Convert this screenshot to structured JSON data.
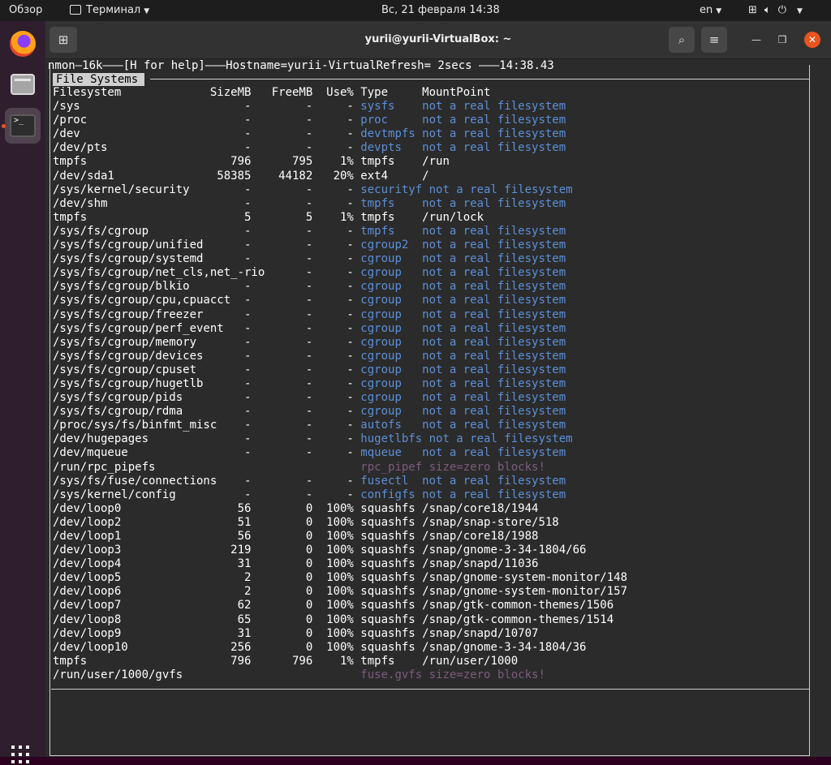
{
  "topbar": {
    "activities": "Обзор",
    "app_menu": "Терминал",
    "clock": "Вс, 21 февраля  14:38",
    "lang": "en"
  },
  "window": {
    "title": "yurii@yurii-VirtualBox: ~"
  },
  "nmon": {
    "header": "nmon—16k———[H for help]———Hostname=yurii-VirtualRefresh= 2secs ———14:38.43",
    "section": "File Systems",
    "columns": "Filesystem             SizeMB   FreeMB  Use% Type     MountPoint",
    "rows": [
      {
        "line": "/sys                        -        -     - ",
        "type": "sysfs    not a real filesystem",
        "style": "dim"
      },
      {
        "line": "/proc                       -        -     - ",
        "type": "proc     not a real filesystem",
        "style": "dim"
      },
      {
        "line": "/dev                        -        -     - ",
        "type": "devtmpfs not a real filesystem",
        "style": "dim"
      },
      {
        "line": "/dev/pts                    -        -     - ",
        "type": "devpts   not a real filesystem",
        "style": "dim"
      },
      {
        "line": "tmpfs                     796      795    1% ",
        "type": "tmpfs    /run",
        "style": "normal"
      },
      {
        "line": "/dev/sda1               58385    44182   20% ",
        "type": "ext4     /",
        "style": "normal"
      },
      {
        "line": "/sys/kernel/security        -        -     - ",
        "type": "securityf not a real filesystem",
        "style": "dim"
      },
      {
        "line": "/dev/shm                    -        -     - ",
        "type": "tmpfs    not a real filesystem",
        "style": "dim"
      },
      {
        "line": "tmpfs                       5        5    1% ",
        "type": "tmpfs    /run/lock",
        "style": "normal"
      },
      {
        "line": "/sys/fs/cgroup              -        -     - ",
        "type": "tmpfs    not a real filesystem",
        "style": "dim"
      },
      {
        "line": "/sys/fs/cgroup/unified      -        -     - ",
        "type": "cgroup2  not a real filesystem",
        "style": "dim"
      },
      {
        "line": "/sys/fs/cgroup/systemd      -        -     - ",
        "type": "cgroup   not a real filesystem",
        "style": "dim"
      },
      {
        "line": "/sys/fs/cgroup/net_cls,net_-rio      -     - ",
        "type": "cgroup   not a real filesystem",
        "style": "dim"
      },
      {
        "line": "/sys/fs/cgroup/blkio        -        -     - ",
        "type": "cgroup   not a real filesystem",
        "style": "dim"
      },
      {
        "line": "/sys/fs/cgroup/cpu,cpuacct  -        -     - ",
        "type": "cgroup   not a real filesystem",
        "style": "dim"
      },
      {
        "line": "/sys/fs/cgroup/freezer      -        -     - ",
        "type": "cgroup   not a real filesystem",
        "style": "dim"
      },
      {
        "line": "/sys/fs/cgroup/perf_event   -        -     - ",
        "type": "cgroup   not a real filesystem",
        "style": "dim"
      },
      {
        "line": "/sys/fs/cgroup/memory       -        -     - ",
        "type": "cgroup   not a real filesystem",
        "style": "dim"
      },
      {
        "line": "/sys/fs/cgroup/devices      -        -     - ",
        "type": "cgroup   not a real filesystem",
        "style": "dim"
      },
      {
        "line": "/sys/fs/cgroup/cpuset       -        -     - ",
        "type": "cgroup   not a real filesystem",
        "style": "dim"
      },
      {
        "line": "/sys/fs/cgroup/hugetlb      -        -     - ",
        "type": "cgroup   not a real filesystem",
        "style": "dim"
      },
      {
        "line": "/sys/fs/cgroup/pids         -        -     - ",
        "type": "cgroup   not a real filesystem",
        "style": "dim"
      },
      {
        "line": "/sys/fs/cgroup/rdma         -        -     - ",
        "type": "cgroup   not a real filesystem",
        "style": "dim"
      },
      {
        "line": "/proc/sys/fs/binfmt_misc    -        -     - ",
        "type": "autofs   not a real filesystem",
        "style": "dim"
      },
      {
        "line": "/dev/hugepages              -        -     - ",
        "type": "hugetlbfs not a real filesystem",
        "style": "dim"
      },
      {
        "line": "/dev/mqueue                 -        -     - ",
        "type": "mqueue   not a real filesystem",
        "style": "dim"
      },
      {
        "line": "/run/rpc_pipefs                              ",
        "type": "rpc_pipef size=zero blocks!",
        "style": "purple"
      },
      {
        "line": "/sys/fs/fuse/connections    -        -     - ",
        "type": "fusectl  not a real filesystem",
        "style": "dim"
      },
      {
        "line": "/sys/kernel/config          -        -     - ",
        "type": "configfs not a real filesystem",
        "style": "dim"
      },
      {
        "line": "/dev/loop0                 56        0  100% ",
        "type": "squashfs /snap/core18/1944",
        "style": "normal"
      },
      {
        "line": "/dev/loop2                 51        0  100% ",
        "type": "squashfs /snap/snap-store/518",
        "style": "normal"
      },
      {
        "line": "/dev/loop1                 56        0  100% ",
        "type": "squashfs /snap/core18/1988",
        "style": "normal"
      },
      {
        "line": "/dev/loop3                219        0  100% ",
        "type": "squashfs /snap/gnome-3-34-1804/66",
        "style": "normal"
      },
      {
        "line": "/dev/loop4                 31        0  100% ",
        "type": "squashfs /snap/snapd/11036",
        "style": "normal"
      },
      {
        "line": "/dev/loop5                  2        0  100% ",
        "type": "squashfs /snap/gnome-system-monitor/148",
        "style": "normal"
      },
      {
        "line": "/dev/loop6                  2        0  100% ",
        "type": "squashfs /snap/gnome-system-monitor/157",
        "style": "normal"
      },
      {
        "line": "/dev/loop7                 62        0  100% ",
        "type": "squashfs /snap/gtk-common-themes/1506",
        "style": "normal"
      },
      {
        "line": "/dev/loop8                 65        0  100% ",
        "type": "squashfs /snap/gtk-common-themes/1514",
        "style": "normal"
      },
      {
        "line": "/dev/loop9                 31        0  100% ",
        "type": "squashfs /snap/snapd/10707",
        "style": "normal"
      },
      {
        "line": "/dev/loop10               256        0  100% ",
        "type": "squashfs /snap/gnome-3-34-1804/36",
        "style": "normal"
      },
      {
        "line": "tmpfs                     796      796    1% ",
        "type": "tmpfs    /run/user/1000",
        "style": "normal"
      },
      {
        "line": "/run/user/1000/gvfs                          ",
        "type": "fuse.gvfs size=zero blocks!",
        "style": "purple"
      }
    ]
  },
  "icons": {
    "dock": [
      "firefox-icon",
      "files-icon",
      "terminal-icon",
      "app-grid-icon"
    ],
    "titlebar": [
      "new-tab-icon",
      "search-icon",
      "hamburger-menu-icon",
      "minimize-icon",
      "maximize-icon",
      "close-icon"
    ]
  },
  "colors": {
    "accent": "#e95420",
    "dim_type": "#5c8fd6",
    "zero_blocks": "#7d5b7d"
  }
}
